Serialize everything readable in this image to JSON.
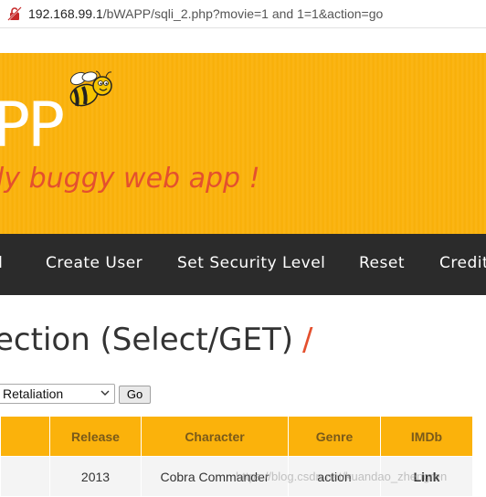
{
  "address_bar": {
    "host": "192.168.99.1",
    "path": "/bWAPP/sqli_2.php?movie=1 and 1=1&action=go"
  },
  "header": {
    "logo_text": "PP",
    "tagline": "ly buggy web app !",
    "accent_color": "#fbb20b",
    "tagline_color": "#e4502e"
  },
  "nav": {
    "items": [
      "d",
      "Create User",
      "Set Security Level",
      "Reset",
      "Credit"
    ]
  },
  "page": {
    "title": "ection (Select/GET)",
    "title_suffix": "/"
  },
  "form": {
    "movie_selected": "Retaliation",
    "go_label": "Go"
  },
  "table": {
    "headers": [
      "Release",
      "Character",
      "Genre",
      "IMDb"
    ],
    "rows": [
      [
        "2013",
        "Cobra Commander",
        "action",
        "Link"
      ]
    ]
  },
  "watermark": "https://blog.csdn.net/kuandao_zhengren"
}
